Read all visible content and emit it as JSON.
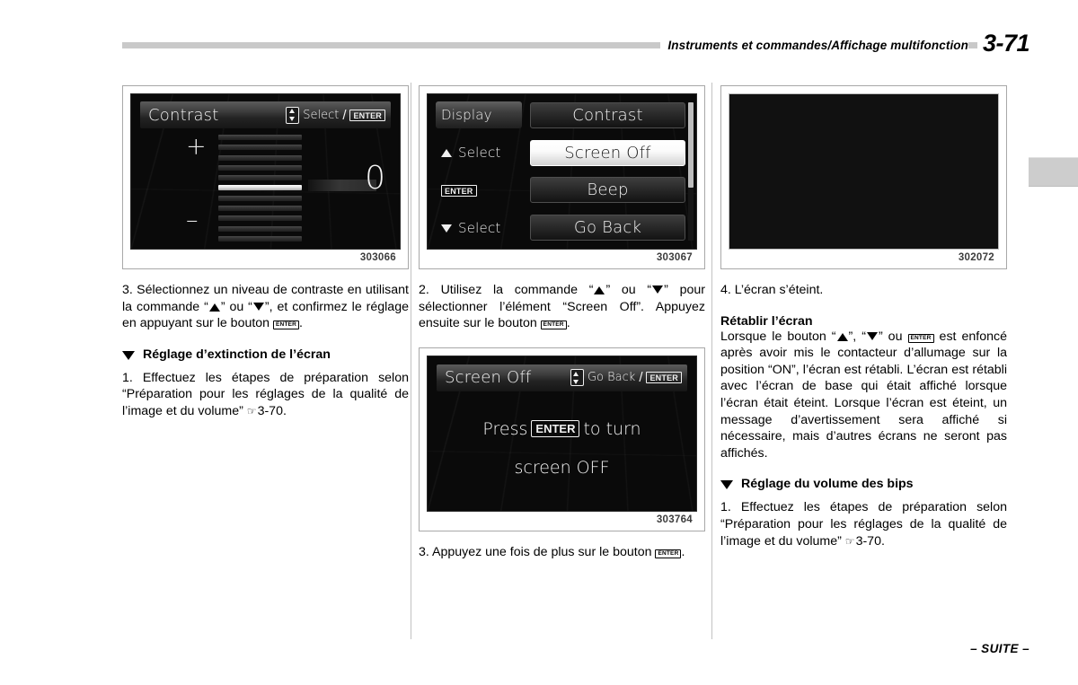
{
  "header": {
    "title": "Instruments et commandes/Affichage multifonction",
    "page_number": "3-71"
  },
  "footer": {
    "continued": "– SUITE –"
  },
  "figures": {
    "contrast": {
      "caption": "303066",
      "title": "Contrast",
      "hint_select": "Select",
      "hint_enter": "ENTER",
      "plus": "+",
      "minus": "–",
      "value": "0",
      "segment_count": 11,
      "active_segment_index": 5
    },
    "display_menu": {
      "caption": "303067",
      "left_items": [
        {
          "label": "Display",
          "icon": "none",
          "style": "chip"
        },
        {
          "label": "Select",
          "icon": "triangle-up",
          "style": "plain"
        },
        {
          "label": "ENTER",
          "icon": "enter-key",
          "style": "plain"
        },
        {
          "label": "Select",
          "icon": "triangle-down",
          "style": "plain"
        }
      ],
      "options": [
        {
          "label": "Contrast",
          "selected": false
        },
        {
          "label": "Screen Off",
          "selected": true
        },
        {
          "label": "Beep",
          "selected": false
        },
        {
          "label": "Go Back",
          "selected": false
        }
      ]
    },
    "blank_screen": {
      "caption": "302072"
    },
    "screen_off": {
      "caption": "303764",
      "title": "Screen Off",
      "hint_goback": "Go Back",
      "hint_enter": "ENTER",
      "message_line1_before": "Press",
      "message_line1_key": "ENTER",
      "message_line1_after": "to turn",
      "message_line2": "screen OFF"
    }
  },
  "column1": {
    "step3_a": "3. Sélectionnez un niveau de contraste en utilisant la commande “",
    "step3_b": "” ou “",
    "step3_c": "”, et confirmez le réglage en appuyant sur le bouton ",
    "step3_d": ".",
    "heading_screen_off": "Réglage d’extinction de l’écran",
    "step1_a": "1. Effectuez les étapes de préparation selon “Préparation pour les réglages de la qualité de l’image et du volume” ",
    "step1_ref": "3-70."
  },
  "column2": {
    "step2_a": "2. Utilisez la commande “",
    "step2_b": "” ou “",
    "step2_c": "” pour sélectionner l’élément “Screen Off”. Appuyez ensuite sur le bouton ",
    "step2_d": ".",
    "step3_a": "3.   Appuyez une fois de plus sur le bouton ",
    "step3_d": "."
  },
  "column3": {
    "step4": "4.  L’écran s’éteint.",
    "heading_restore": "Rétablir l’écran",
    "restore_a": "Lorsque le bouton “",
    "restore_b": "”, “",
    "restore_c": "” ou ",
    "restore_d": " est enfoncé après avoir mis le contacteur d’allumage sur la position “ON”, l’écran est rétabli. L’écran est rétabli avec l’écran de base qui était affiché lorsque l’écran était éteint. Lorsque l’écran est éteint, un message d’avertissement sera affiché si nécessaire, mais d’autres écrans ne seront pas affichés.",
    "heading_beep": "Réglage du volume des bips",
    "step1_a": "1. Effectuez les étapes de préparation selon “Préparation pour les réglages de la qualité de l’image et du volume” ",
    "step1_ref": "3-70."
  }
}
